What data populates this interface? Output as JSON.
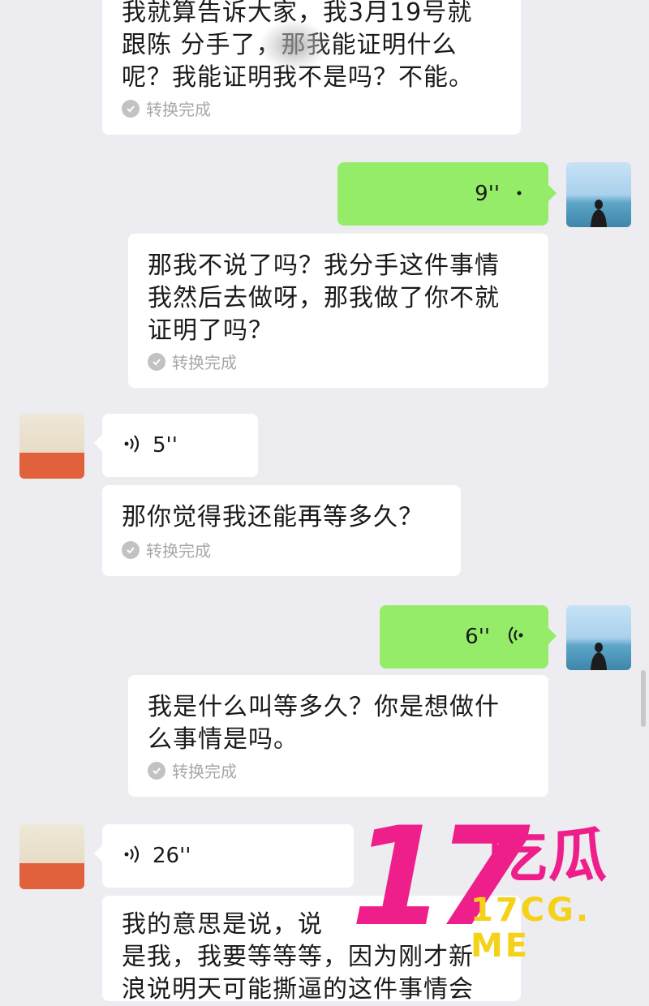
{
  "messages": [
    {
      "type": "text",
      "sender": "other",
      "lines": [
        "我就算告诉大家，我3月19号就",
        "跟陈 分手了，那我能证明什么",
        "呢？我能证明我不是吗？不能。"
      ],
      "status": "转换完成"
    },
    {
      "type": "voice",
      "sender": "self",
      "duration": "9''"
    },
    {
      "type": "text",
      "sender": "self",
      "lines": [
        "那我不说了吗？我分手这件事情",
        "我然后去做呀，那我做了你不就",
        "证明了吗？"
      ],
      "status": "转换完成"
    },
    {
      "type": "voice",
      "sender": "other",
      "duration": "5''"
    },
    {
      "type": "text",
      "sender": "other",
      "lines": [
        "那你觉得我还能再等多久？"
      ],
      "status": "转换完成"
    },
    {
      "type": "voice",
      "sender": "self",
      "duration": "6''"
    },
    {
      "type": "text",
      "sender": "self",
      "lines": [
        "我是什么叫等多久？你是想做什",
        "么事情是吗。"
      ],
      "status": "转换完成"
    },
    {
      "type": "voice",
      "sender": "other",
      "duration": "26''"
    },
    {
      "type": "text",
      "sender": "other",
      "lines": [
        "我的意思是说，说",
        "是我，我要等等等，因为刚才新",
        "浪说明天可能撕逼的这件事情会"
      ]
    }
  ],
  "watermark": {
    "number": "17",
    "chinese": "吃瓜",
    "url": "17CG. ME"
  },
  "colors": {
    "outgoing_bubble": "#95ec69",
    "incoming_bubble": "#ffffff",
    "background": "#ededf1",
    "watermark_pink": "#ee1e8a",
    "watermark_yellow": "#f4d21a"
  },
  "icons": {
    "voice_in": "voice-wave-icon",
    "voice_out": "voice-wave-icon",
    "status": "check-circle-icon"
  }
}
